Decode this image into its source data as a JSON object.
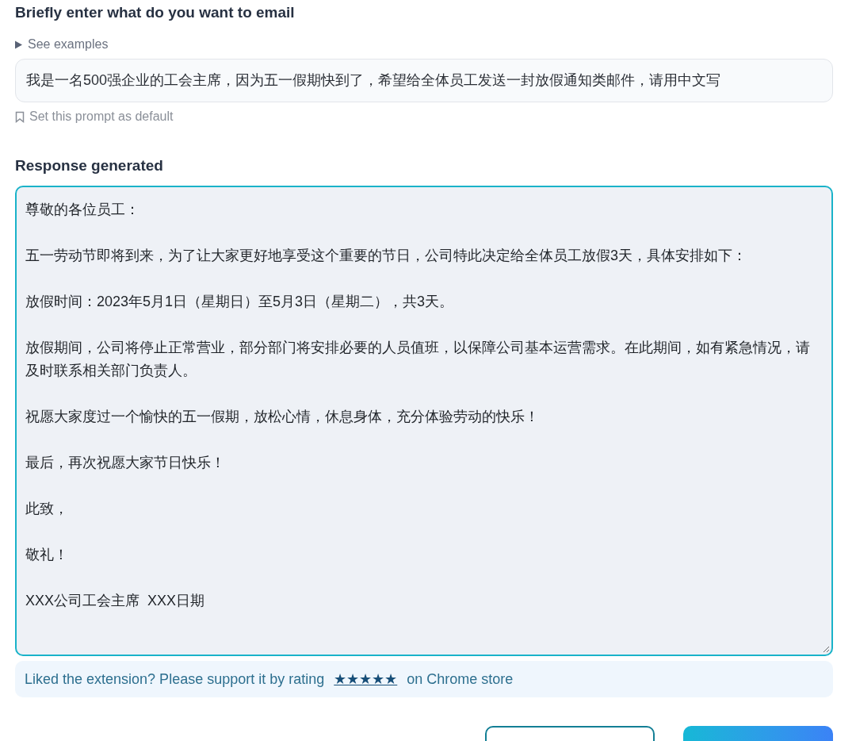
{
  "prompt_section": {
    "heading": "Briefly enter what do you want to email",
    "examples_toggle": {
      "label": "See examples",
      "expanded": false
    },
    "prompt_value": "我是一名500强企业的工会主席，因为五一假期快到了，希望给全体员工发送一封放假通知类邮件，请用中文写",
    "default_link": "Set this prompt as default"
  },
  "response_section": {
    "heading": "Response generated",
    "paragraphs": [
      "尊敬的各位员工：",
      "五一劳动节即将到来，为了让大家更好地享受这个重要的节日，公司特此决定给全体员工放假3天，具体安排如下：",
      "放假时间：2023年5月1日（星期日）至5月3日（星期二），共3天。",
      "放假期间，公司将停止正常营业，部分部门将安排必要的人员值班，以保障公司基本运营需求。在此期间，如有紧急情况，请及时联系相关部门负责人。",
      "祝愿大家度过一个愉快的五一假期，放松心情，休息身体，充分体验劳动的快乐！",
      "最后，再次祝愿大家节日快乐！",
      "此致，",
      "敬礼！",
      "XXX公司工会主席  XXX日期"
    ]
  },
  "rating_banner": {
    "text_before": "Liked the extension? Please support it by rating",
    "stars_link": "★★★★★",
    "text_after": "on Chrome store"
  }
}
